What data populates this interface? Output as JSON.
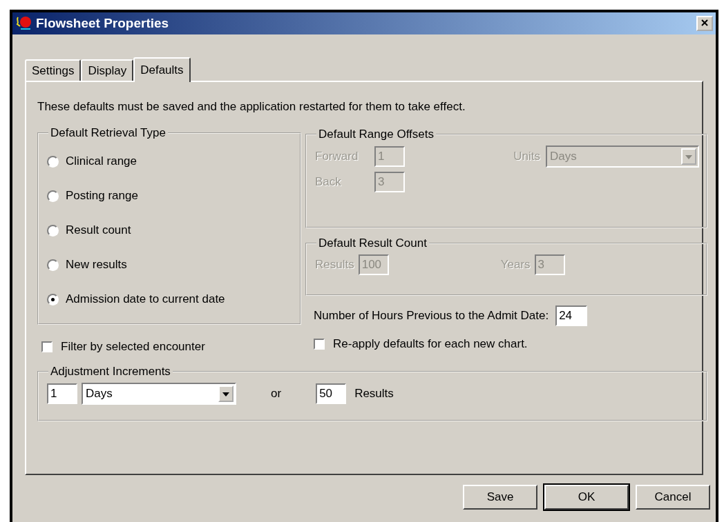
{
  "window": {
    "title": "Flowsheet Properties"
  },
  "tabs": [
    {
      "label": "Settings",
      "selected": false
    },
    {
      "label": "Display",
      "selected": false
    },
    {
      "label": "Defaults",
      "selected": true
    }
  ],
  "notice": "These defaults must be saved and the application restarted for them to take effect.",
  "retrieval_type": {
    "title": "Default Retrieval Type",
    "options": [
      {
        "label": "Clinical range",
        "selected": false
      },
      {
        "label": "Posting range",
        "selected": false
      },
      {
        "label": "Result count",
        "selected": false
      },
      {
        "label": "New results",
        "selected": false
      },
      {
        "label": "Admission date to current date",
        "selected": true
      }
    ]
  },
  "filter_by_encounter": {
    "label": "Filter by selected encounter",
    "checked": false
  },
  "range_offsets": {
    "title": "Default Range Offsets",
    "forward": {
      "label": "Forward",
      "value": "1",
      "disabled": true
    },
    "back": {
      "label": "Back",
      "value": "3",
      "disabled": true
    },
    "units": {
      "label": "Units",
      "value": "Days",
      "disabled": true
    }
  },
  "result_count": {
    "title": "Default Result Count",
    "results": {
      "label": "Results",
      "value": "100",
      "disabled": true
    },
    "years": {
      "label": "Years",
      "value": "3",
      "disabled": true
    }
  },
  "hours_previous": {
    "label": "Number of Hours Previous to the Admit Date:",
    "value": "24"
  },
  "reapply_defaults": {
    "label": "Re-apply defaults for each new chart.",
    "checked": false
  },
  "adjustment": {
    "title": "Adjustment Increments",
    "amount": "1",
    "unit": "Days",
    "or": "or",
    "count": "50",
    "count_label": "Results"
  },
  "buttons": [
    {
      "label": "Save",
      "default": false
    },
    {
      "label": "OK",
      "default": true
    },
    {
      "label": "Cancel",
      "default": false
    }
  ]
}
